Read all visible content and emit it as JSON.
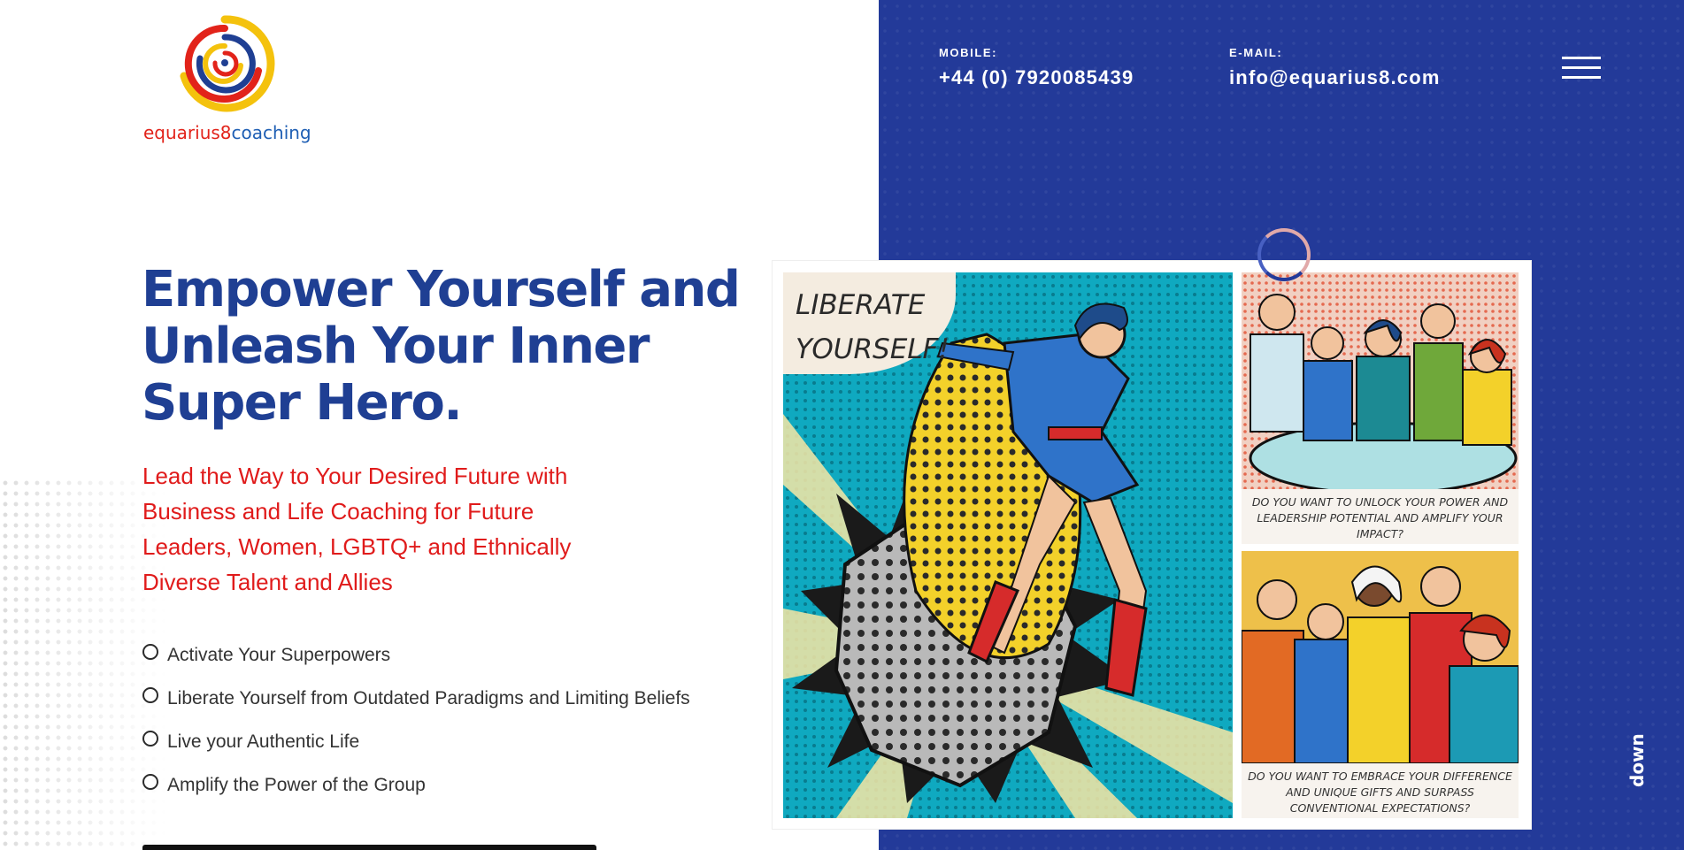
{
  "brand": {
    "logo_part1": "equarius8",
    "logo_part2": "coaching"
  },
  "contact": {
    "mobile_label": "MOBILE:",
    "mobile_value": "+44 (0) 7920085439",
    "email_label": "E-MAIL:",
    "email_value": "info@equarius8.com"
  },
  "hero": {
    "headline_line1": "Empower Yourself and",
    "headline_line2": "Unleash Your Inner",
    "headline_line3": "Super Hero.",
    "subhead": "Lead the Way to Your Desired Future with Business and Life Coaching for Future Leaders, Women, LGBTQ+ and Ethnically Diverse Talent and Allies",
    "bullets": [
      "Activate Your Superpowers",
      "Liberate Yourself from Outdated Paradigms and Limiting Beliefs",
      "Live your Authentic Life",
      "Amplify the Power of the Group"
    ]
  },
  "comic": {
    "bubble_line1": "LIBERATE",
    "bubble_line2": "YOURSELF!",
    "caption_top": "DO YOU WANT TO UNLOCK YOUR POWER AND LEADERSHIP POTENTIAL AND AMPLIFY YOUR IMPACT?",
    "caption_bottom": "DO YOU WANT TO EMBRACE YOUR DIFFERENCE AND UNIQUE GIFTS AND SURPASS CONVENTIONAL EXPECTATIONS?"
  },
  "scroll": {
    "label": "down"
  },
  "colors": {
    "brand_blue": "#233a99",
    "headline_blue": "#1f3f93",
    "accent_red": "#e01b1b",
    "logo_yellow": "#f4c20d"
  }
}
